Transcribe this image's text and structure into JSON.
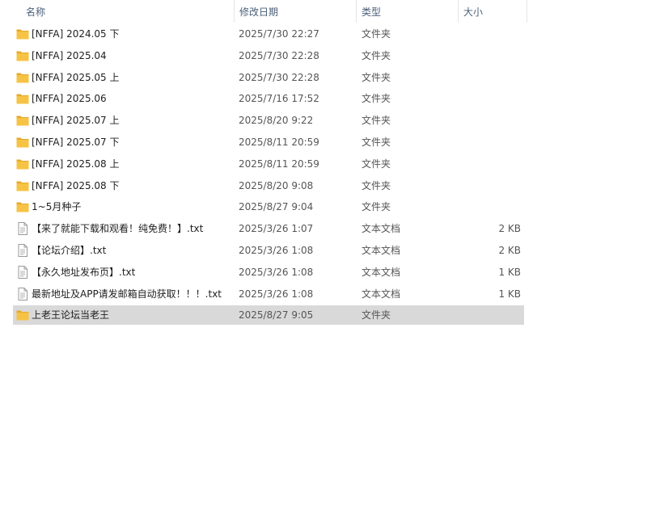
{
  "columns": {
    "name": "名称",
    "date": "修改日期",
    "type": "类型",
    "size": "大小"
  },
  "sort_indicator": "^",
  "files": [
    {
      "name": "[NFFA] 2024.05 下",
      "date": "2025/7/30 22:27",
      "type": "文件夹",
      "size": "",
      "icon": "folder-icon"
    },
    {
      "name": "[NFFA] 2025.04",
      "date": "2025/7/30 22:28",
      "type": "文件夹",
      "size": "",
      "icon": "folder-icon"
    },
    {
      "name": "[NFFA] 2025.05 上",
      "date": "2025/7/30 22:28",
      "type": "文件夹",
      "size": "",
      "icon": "folder-icon"
    },
    {
      "name": "[NFFA] 2025.06",
      "date": "2025/7/16 17:52",
      "type": "文件夹",
      "size": "",
      "icon": "folder-icon"
    },
    {
      "name": "[NFFA] 2025.07 上",
      "date": "2025/8/20 9:22",
      "type": "文件夹",
      "size": "",
      "icon": "folder-icon"
    },
    {
      "name": "[NFFA] 2025.07 下",
      "date": "2025/8/11 20:59",
      "type": "文件夹",
      "size": "",
      "icon": "folder-icon"
    },
    {
      "name": "[NFFA] 2025.08 上",
      "date": "2025/8/11 20:59",
      "type": "文件夹",
      "size": "",
      "icon": "folder-icon"
    },
    {
      "name": "[NFFA] 2025.08 下",
      "date": "2025/8/20 9:08",
      "type": "文件夹",
      "size": "",
      "icon": "folder-icon"
    },
    {
      "name": "1~5月种子",
      "date": "2025/8/27 9:04",
      "type": "文件夹",
      "size": "",
      "icon": "folder-icon"
    },
    {
      "name": "【来了就能下载和观看！纯免费！】.txt",
      "date": "2025/3/26 1:07",
      "type": "文本文档",
      "size": "2 KB",
      "icon": "text-file-icon"
    },
    {
      "name": "【论坛介绍】.txt",
      "date": "2025/3/26 1:08",
      "type": "文本文档",
      "size": "2 KB",
      "icon": "text-file-icon"
    },
    {
      "name": "【永久地址发布页】.txt",
      "date": "2025/3/26 1:08",
      "type": "文本文档",
      "size": "1 KB",
      "icon": "text-file-icon"
    },
    {
      "name": "最新地址及APP请发邮箱自动获取！！！.txt",
      "date": "2025/3/26 1:08",
      "type": "文本文档",
      "size": "1 KB",
      "icon": "text-file-icon"
    },
    {
      "name": "上老王论坛当老王",
      "date": "2025/8/27 9:05",
      "type": "文件夹",
      "size": "",
      "icon": "folder-icon",
      "selected": true
    }
  ],
  "colors": {
    "folder": "#f6c344",
    "folder_dark": "#e8a82a",
    "selection": "#d9d9d9",
    "header_text": "#4c607a"
  }
}
